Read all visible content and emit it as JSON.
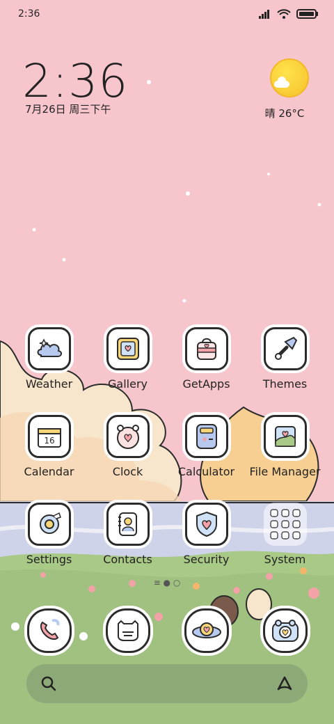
{
  "status": {
    "time": "2:36"
  },
  "lockscreen_clock": {
    "time": "2:36",
    "date": "7月26日 周三下午"
  },
  "weather": {
    "condition_temp": "晴 26°C",
    "icon": "sun-cloud-icon"
  },
  "apps": [
    {
      "label": "Weather",
      "icon": "weather-icon"
    },
    {
      "label": "Gallery",
      "icon": "gallery-icon"
    },
    {
      "label": "GetApps",
      "icon": "getapps-icon"
    },
    {
      "label": "Themes",
      "icon": "themes-icon"
    },
    {
      "label": "Calendar",
      "icon": "calendar-icon",
      "badge": "16"
    },
    {
      "label": "Clock",
      "icon": "clock-icon"
    },
    {
      "label": "Calculator",
      "icon": "calculator-icon"
    },
    {
      "label": "File Manager",
      "icon": "file-manager-icon"
    },
    {
      "label": "Settings",
      "icon": "settings-icon"
    },
    {
      "label": "Contacts",
      "icon": "contacts-icon"
    },
    {
      "label": "Security",
      "icon": "security-icon"
    },
    {
      "label": "System",
      "icon": "system-folder-icon"
    }
  ],
  "dock": [
    {
      "icon": "phone-icon"
    },
    {
      "icon": "messages-icon"
    },
    {
      "icon": "browser-icon"
    },
    {
      "icon": "camera-icon"
    }
  ],
  "colors": {
    "sky": "#f7c6cd",
    "grass": "#a9c987",
    "water": "#cfd3ea",
    "cloud": "#f7e6cc",
    "moon": "#f8cf92"
  }
}
